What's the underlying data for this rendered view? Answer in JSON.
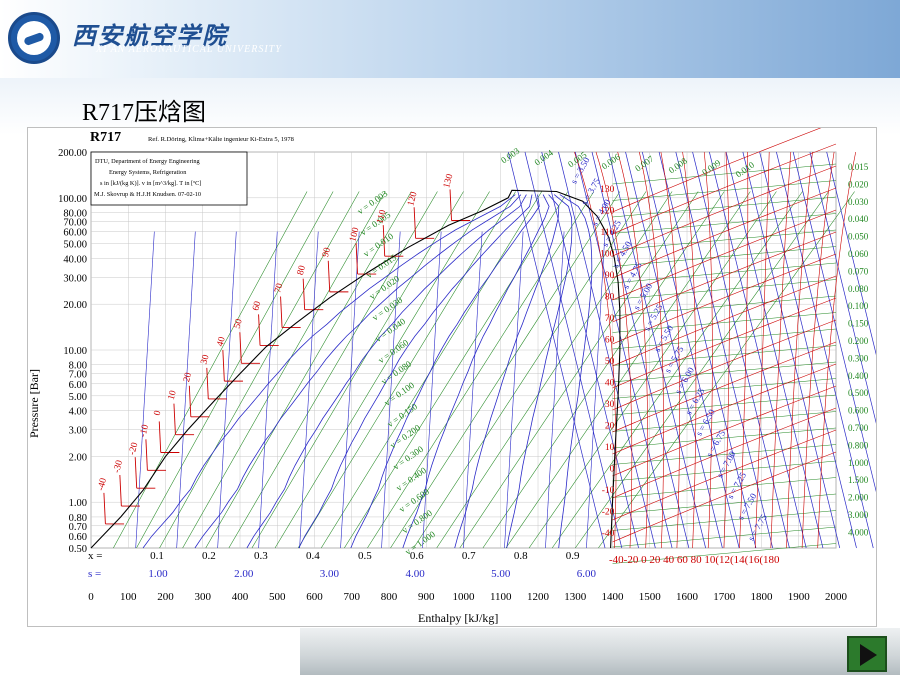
{
  "header": {
    "university_cn": "西安航空学院",
    "university_en": "XI'AN AERONAUTICAL UNIVERSITY"
  },
  "slide": {
    "title": "R717压焓图"
  },
  "colors": {
    "grid": "#c8c8c8",
    "saturation": "#000000",
    "isotherm": "#cc0000",
    "entropy": "#2a2ac8",
    "volume": "#228822",
    "quality": "#2a2ac8"
  },
  "icons": {
    "logo": "university-logo",
    "next": "next-arrow-icon"
  },
  "chart_data": {
    "type": "line",
    "title": "R717",
    "ref_text": "Ref. R.Döring, Klima+Kälte ingenieur Ki-Extra 5, 1978",
    "info_box": [
      "DTU, Department of Energy Engineering",
      "Energy Systems, Refrigeration",
      "s in [kJ/(kg K)]. v in [m^3/kg]. T in [ºC]",
      "M.J. Skovrup & H.J.H Knudsen. 07-02-10"
    ],
    "xlabel": "Enthalpy [kJ/kg]",
    "ylabel": "Pressure [Bar]",
    "xlim": [
      0,
      2000
    ],
    "ylim": [
      0.5,
      200
    ],
    "y_scale": "log",
    "grid": true,
    "x_ticks": [
      "0",
      "100",
      "200",
      "300",
      "400",
      "500",
      "600",
      "700",
      "800",
      "900",
      "1000",
      "1100",
      "1200",
      "1300",
      "1400",
      "1500",
      "1600",
      "1700",
      "1800",
      "1900",
      "2000"
    ],
    "y_ticks": [
      "200.00",
      "100.00",
      "80.00",
      "70.00",
      "60.00",
      "50.00",
      "40.00",
      "30.00",
      "20.00",
      "10.00",
      "8.00",
      "7.00",
      "6.00",
      "5.00",
      "4.00",
      "3.00",
      "2.00",
      "1.00",
      "0.80",
      "0.70",
      "0.60",
      "0.50"
    ],
    "x_quality_label": "x =",
    "x_quality_values": [
      "0.1",
      "0.2",
      "0.3",
      "0.4",
      "0.5",
      "0.6",
      "0.7",
      "0.8",
      "0.9"
    ],
    "s_label": "s =",
    "s_values": [
      "1.00",
      "2.00",
      "3.00",
      "4.00",
      "5.00",
      "6.00"
    ],
    "isotherms_liquid": [
      "-40",
      "-30",
      "-20",
      "-10",
      "0",
      "10",
      "20",
      "30",
      "40",
      "50",
      "60",
      "70",
      "80",
      "90",
      "100",
      "110",
      "120",
      "130"
    ],
    "isotherms_vapor": [
      "130",
      "120",
      "110",
      "100",
      "90",
      "80",
      "70",
      "60",
      "50",
      "40",
      "30",
      "20",
      "10",
      "0",
      "-10",
      "-20",
      "-40"
    ],
    "isotherm_bottom_labels": "-40-20  0  20 40 60 80 10(12(14(16(180",
    "volume_left": [
      "v = 0.003",
      "v = 0.005",
      "v = 0.010",
      "v = 0.015",
      "v = 0.020",
      "v = 0.030",
      "v = 0.040",
      "v = 0.060",
      "v = 0.080",
      "v = 0.100",
      "v = 0.150",
      "v = 0.200",
      "v = 0.300",
      "v = 0.400",
      "v = 0.600",
      "v = 0.800",
      "v = 1.000"
    ],
    "volume_top": [
      "0.003",
      "0.004",
      "0.005",
      "0.006",
      "0.007",
      "0.008",
      "0.009",
      "0.010"
    ],
    "volume_right": [
      "0.015",
      "0.020",
      "0.030",
      "0.040",
      "0.050",
      "0.060",
      "0.070",
      "0.080",
      "0.100",
      "0.150",
      "0.200",
      "0.300",
      "0.400",
      "0.500",
      "0.600",
      "0.700",
      "0.800",
      "1.000",
      "1.500",
      "2.000",
      "3.000",
      "4.000"
    ],
    "entropy_labels": [
      "s = 3.50",
      "s = 3.75",
      "s = 4.00",
      "s = 4.25",
      "s = 4.50",
      "s = 4.75",
      "s = 5.00",
      "s = 5.25",
      "s = 5.50",
      "s = 5.75",
      "s = 6.00",
      "s = 6.25",
      "s = 6.50",
      "s = 6.75",
      "s = 7.00",
      "s = 7.25",
      "s = 7.50",
      "s = 7.75"
    ],
    "saturation_liquid": [
      [
        0,
        0.5
      ],
      [
        80,
        0.8
      ],
      [
        140,
        1.2
      ],
      [
        200,
        2.0
      ],
      [
        260,
        3.0
      ],
      [
        330,
        4.6
      ],
      [
        400,
        7.0
      ],
      [
        470,
        10.5
      ],
      [
        550,
        15.0
      ],
      [
        640,
        22.0
      ],
      [
        740,
        32.0
      ],
      [
        850,
        47.0
      ],
      [
        960,
        66.0
      ],
      [
        1050,
        82.0
      ],
      [
        1120,
        100.0
      ],
      [
        1130,
        112.0
      ]
    ],
    "saturation_vapor": [
      [
        1130,
        112.0
      ],
      [
        1250,
        110.0
      ],
      [
        1320,
        95.0
      ],
      [
        1360,
        75.0
      ],
      [
        1390,
        55.0
      ],
      [
        1405,
        40.0
      ],
      [
        1415,
        28.0
      ],
      [
        1420,
        18.0
      ],
      [
        1420,
        10.0
      ],
      [
        1415,
        5.0
      ],
      [
        1408,
        2.5
      ],
      [
        1400,
        1.0
      ],
      [
        1395,
        0.5
      ]
    ]
  }
}
